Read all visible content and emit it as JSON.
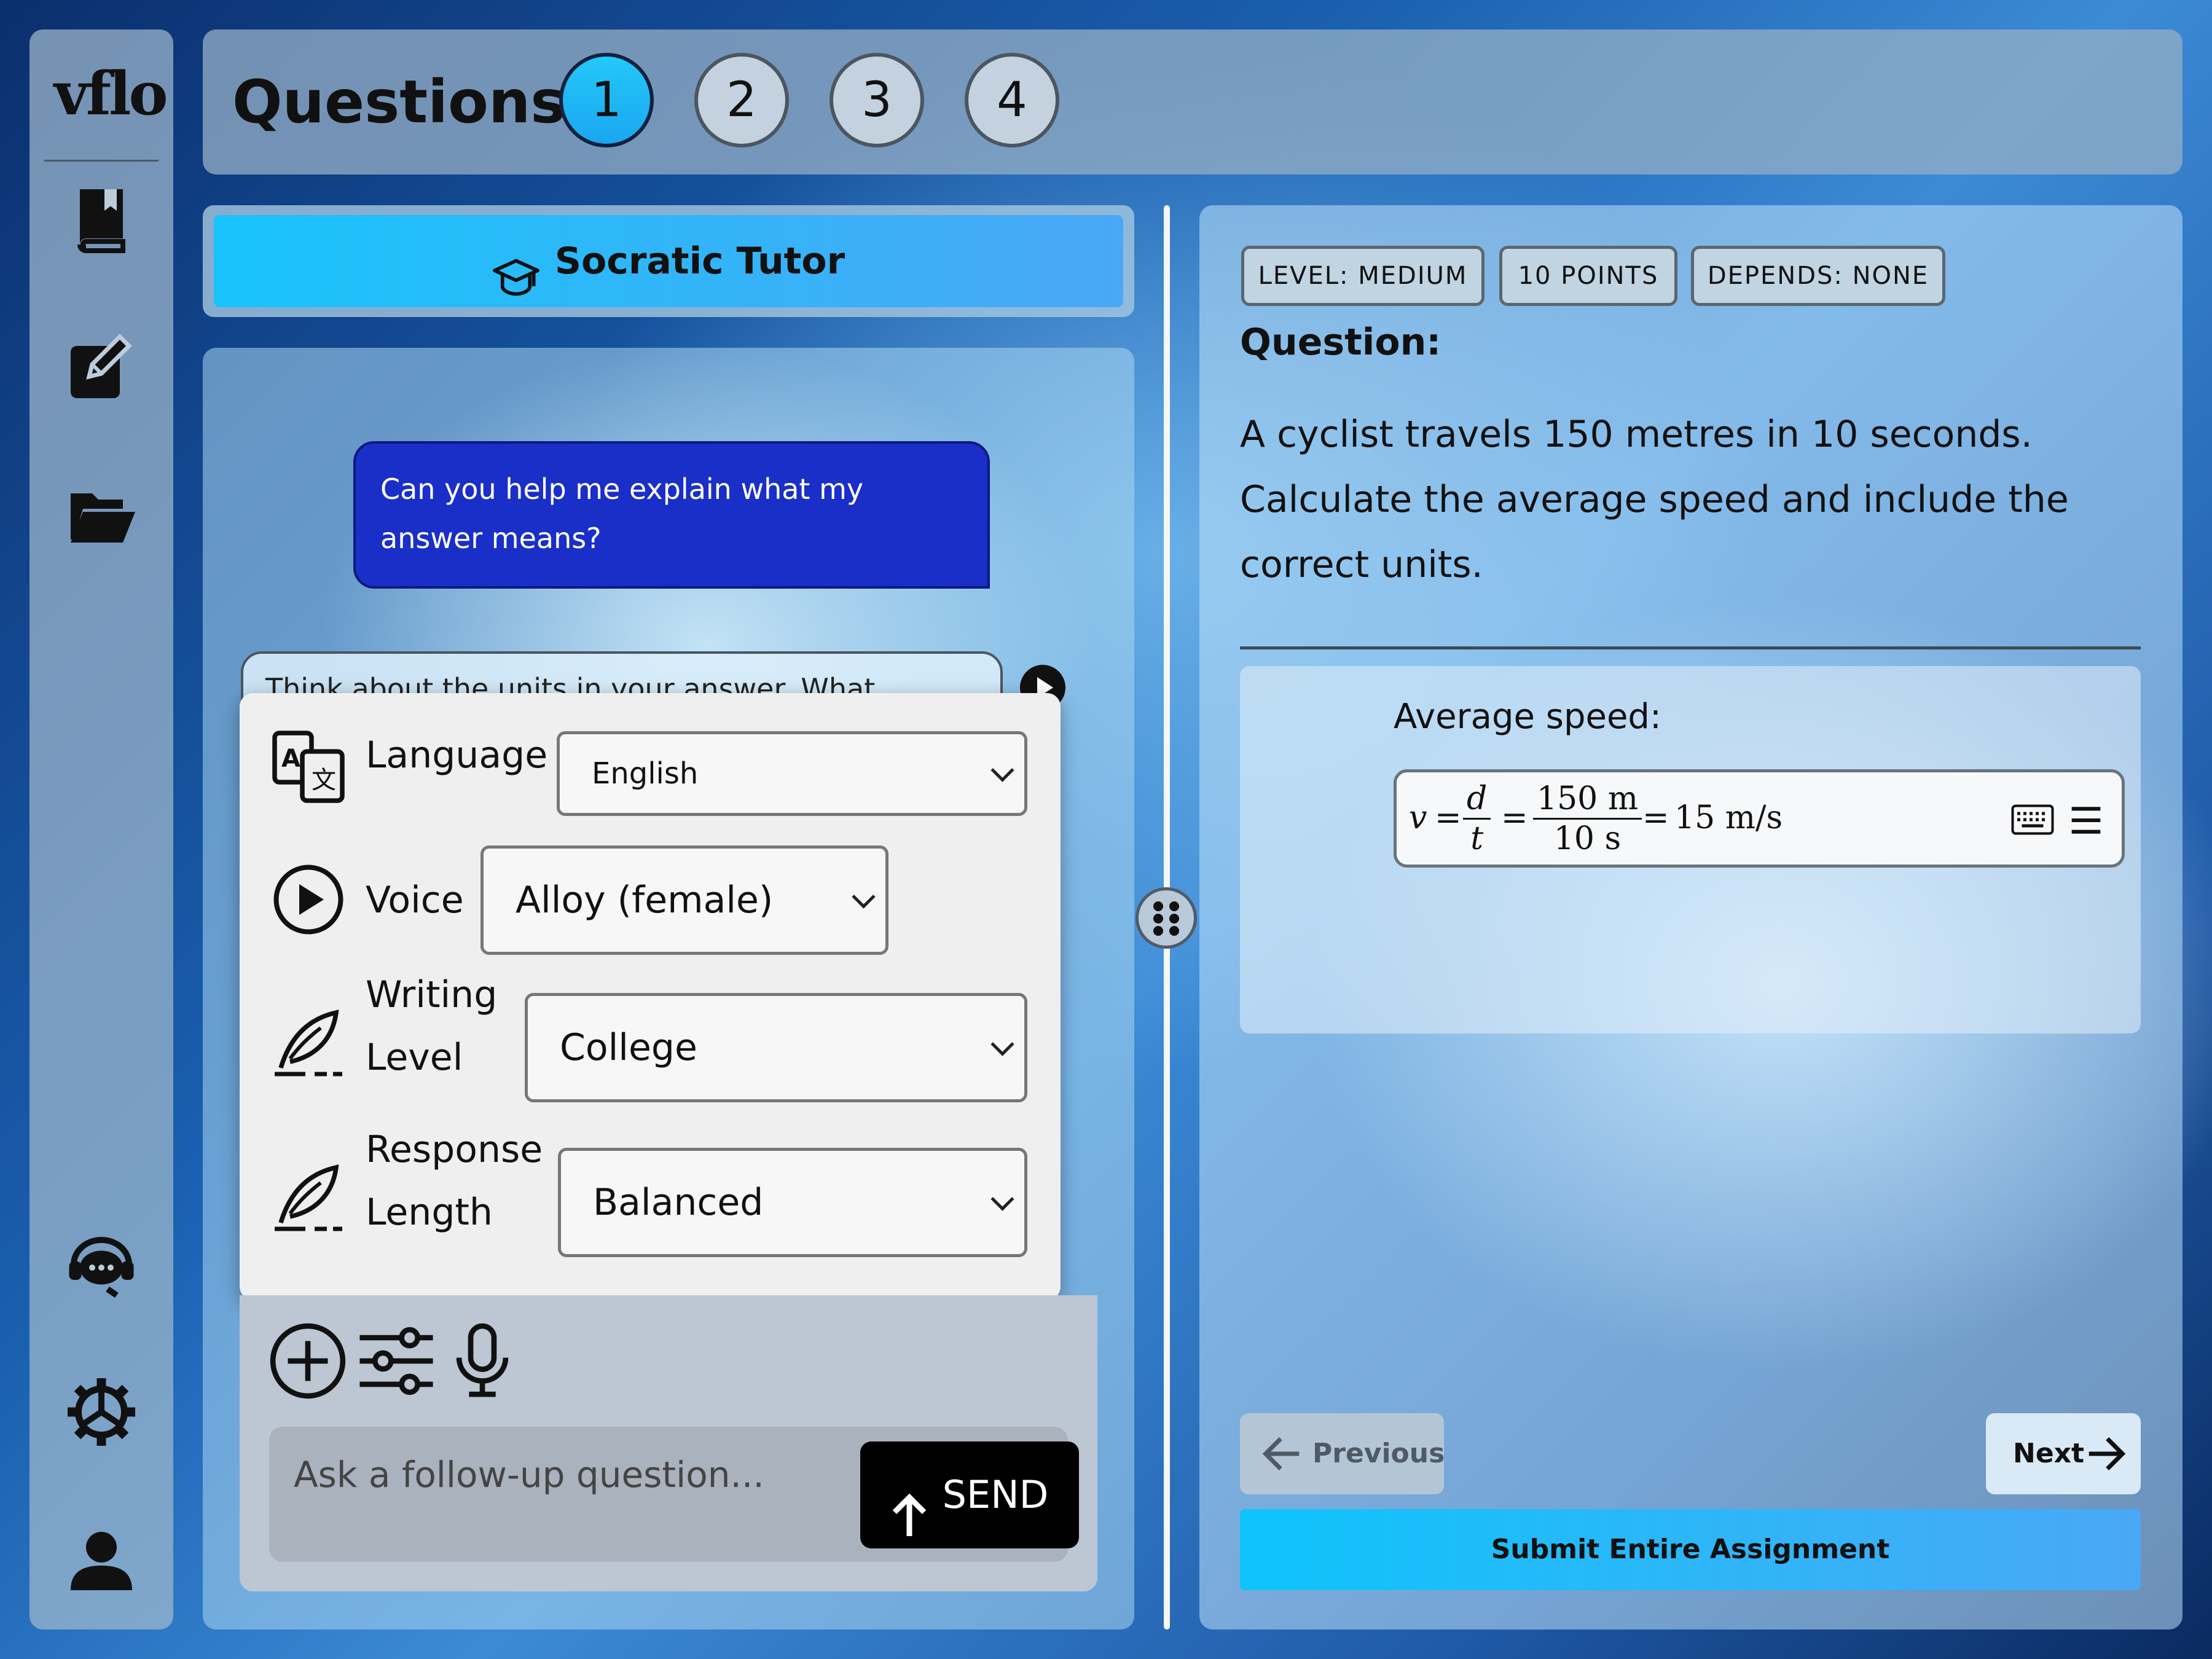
{
  "app": {
    "logo_text": "vflo"
  },
  "sidebar": {
    "items": [
      {
        "name": "book-icon"
      },
      {
        "name": "edit-icon"
      },
      {
        "name": "folder-icon"
      },
      {
        "name": "support-chat-icon"
      },
      {
        "name": "settings-gear-icon"
      },
      {
        "name": "user-profile-icon"
      }
    ]
  },
  "header": {
    "title": "Questions",
    "questions": [
      "1",
      "2",
      "3",
      "4"
    ],
    "active_question": "1"
  },
  "tutor": {
    "header_label": "Socratic Tutor",
    "user_message": "Can you help me explain what my answer means?",
    "ai_message_partial": "Think about the units in your answer. What"
  },
  "settings": {
    "language": {
      "label": "Language",
      "value": "English"
    },
    "voice": {
      "label": "Voice",
      "value": "Alloy (female)"
    },
    "writing_level": {
      "label_line1": "Writing",
      "label_line2": "Level",
      "value": "College"
    },
    "response_length": {
      "label_line1": "Response",
      "label_line2": "Length",
      "value": "Balanced"
    }
  },
  "composer": {
    "placeholder": "Ask a follow-up question...",
    "send_label": "SEND"
  },
  "question": {
    "tags": [
      "LEVEL: MEDIUM",
      "10 POINTS",
      "DEPENDS: NONE"
    ],
    "heading": "Question:",
    "text": "A cyclist travels 150 metres in 10 seconds. Calculate the average speed and include the correct units.",
    "answer_label": "Average speed:",
    "answer_math": {
      "variable": "v",
      "frac1_num": "d",
      "frac1_den": "t",
      "frac2_num": "150 m",
      "frac2_den": "10 s",
      "result": "15 m/s"
    }
  },
  "navigation": {
    "previous_label": "Previous",
    "next_label": "Next",
    "submit_label": "Submit Entire Assignment"
  },
  "colors": {
    "accent": "#18c3fb",
    "user_bubble": "#1a2ec8",
    "send_button": "#000000"
  }
}
